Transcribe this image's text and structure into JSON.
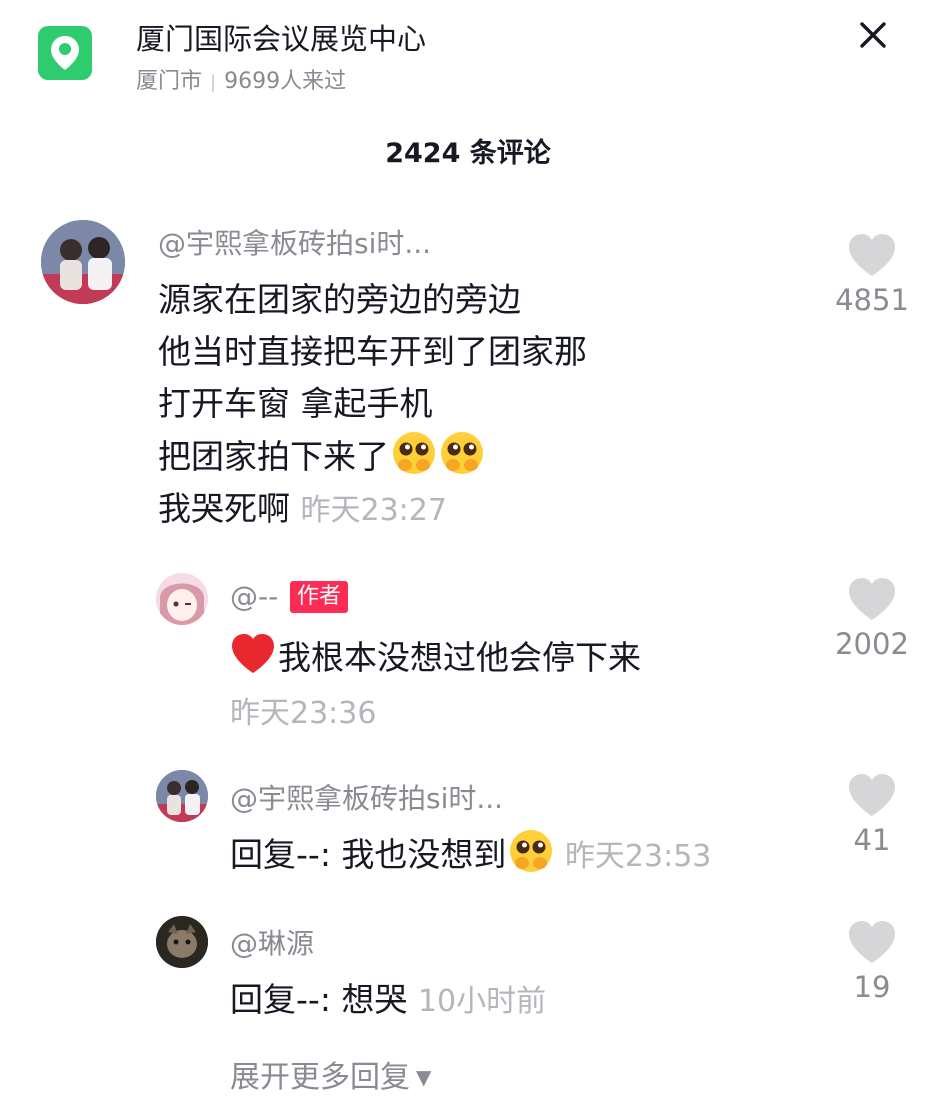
{
  "header": {
    "title": "厦门国际会议展览中心",
    "city": "厦门市",
    "separator": "|",
    "visitors": "9699人来过"
  },
  "comments_count": "2424 条评论",
  "main_comment": {
    "username": "@宇熙拿板砖拍si时...",
    "lines": [
      "源家在团家的旁边的旁边",
      "他当时直接把车开到了团家那",
      "打开车窗 拿起手机",
      "把团家拍下来了",
      "我哭死啊"
    ],
    "time": "昨天23:27",
    "likes": "4851"
  },
  "replies": [
    {
      "username": "@--",
      "badge": "作者",
      "text": "我根本没想过他会停下来",
      "time": "昨天23:36",
      "likes": "2002"
    },
    {
      "username": "@宇熙拿板砖拍si时...",
      "text": "回复--: 我也没想到",
      "time": "昨天23:53",
      "likes": "41"
    },
    {
      "username": "@琳源",
      "text": "回复--: 想哭",
      "time": "10小时前",
      "likes": "19"
    }
  ],
  "expand_label": "展开更多回复",
  "colors": {
    "location_green": "#2ecb6f",
    "author_badge": "#fe2c55",
    "muted_text": "#8a8a92",
    "timestamp": "#b5b5bb",
    "like_heart": "#d6d6d9"
  },
  "icons": [
    "location-pin-icon",
    "close-icon",
    "heart-outline-icon",
    "emoji-moved-face-icon",
    "red-heart-icon",
    "caret-down-icon"
  ]
}
